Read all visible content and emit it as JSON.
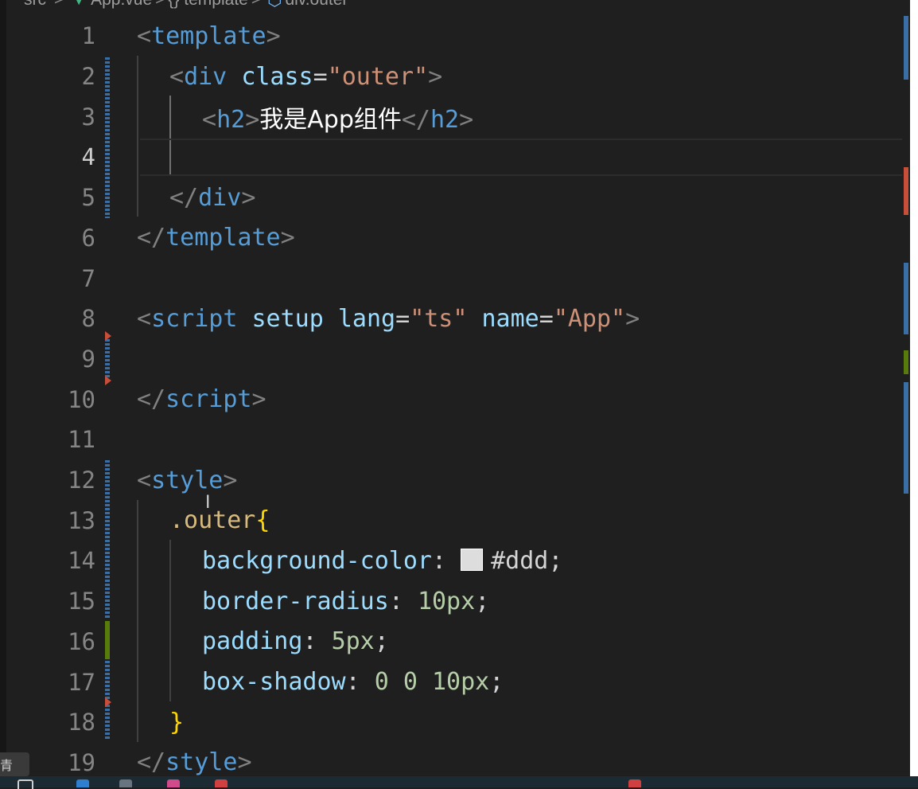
{
  "breadcrumb": {
    "items": [
      "src",
      "App.vue",
      "{} template",
      "div.outer"
    ],
    "separator": ">"
  },
  "editor": {
    "current_line": 4,
    "line_numbers": [
      "1",
      "2",
      "3",
      "4",
      "5",
      "6",
      "7",
      "8",
      "9",
      "10",
      "11",
      "12",
      "13",
      "14",
      "15",
      "16",
      "17",
      "18",
      "19"
    ],
    "lines": {
      "l1": {
        "open": "<",
        "tag": "template",
        "close": ">"
      },
      "l2": {
        "open": "<",
        "tag": "div",
        "attr": "class",
        "eq": "=",
        "str": "\"outer\"",
        "close": ">"
      },
      "l3": {
        "open": "<",
        "tag": "h2",
        "close": ">",
        "text": "我是App组件",
        "open2": "</",
        "tag2": "h2",
        "close2": ">"
      },
      "l5": {
        "open": "</",
        "tag": "div",
        "close": ">"
      },
      "l6": {
        "open": "</",
        "tag": "template",
        "close": ">"
      },
      "l8": {
        "open": "<",
        "tag": "script",
        "attr1": "setup",
        "attr2": "lang",
        "eq": "=",
        "str2": "\"ts\"",
        "attr3": "name",
        "str3": "\"App\"",
        "close": ">"
      },
      "l10": {
        "open": "</",
        "tag": "script",
        "close": ">"
      },
      "l12": {
        "open": "<",
        "tag": "style",
        "close": ">"
      },
      "l13": {
        "selector": ".outer",
        "brace": "{"
      },
      "l14": {
        "prop": "background-color",
        "colon": ":",
        "value": "#ddd",
        "semi": ";"
      },
      "l15": {
        "prop": "border-radius",
        "colon": ":",
        "num": "10px",
        "semi": ";"
      },
      "l16": {
        "prop": "padding",
        "colon": ":",
        "num": "5px",
        "semi": ";"
      },
      "l17": {
        "prop": "box-shadow",
        "colon": ":",
        "n1": "0",
        "n2": "0",
        "n3": "10px",
        "semi": ";"
      },
      "l18": {
        "brace": "}"
      },
      "l19": {
        "open": "</",
        "tag": "style",
        "close": ">"
      }
    },
    "swatch_color": "#dddddd"
  },
  "colors": {
    "background": "#1f1f1f",
    "tag": "#569cd6",
    "attribute": "#9cdcfe",
    "string": "#ce9178",
    "selector": "#d7ba7d",
    "brace": "#ffd700",
    "number": "#b5cea8",
    "git_modified": "#3a6fa6",
    "git_added": "#587c0c",
    "git_deleted": "#c74e39"
  },
  "popup": {
    "glyph": "青"
  }
}
